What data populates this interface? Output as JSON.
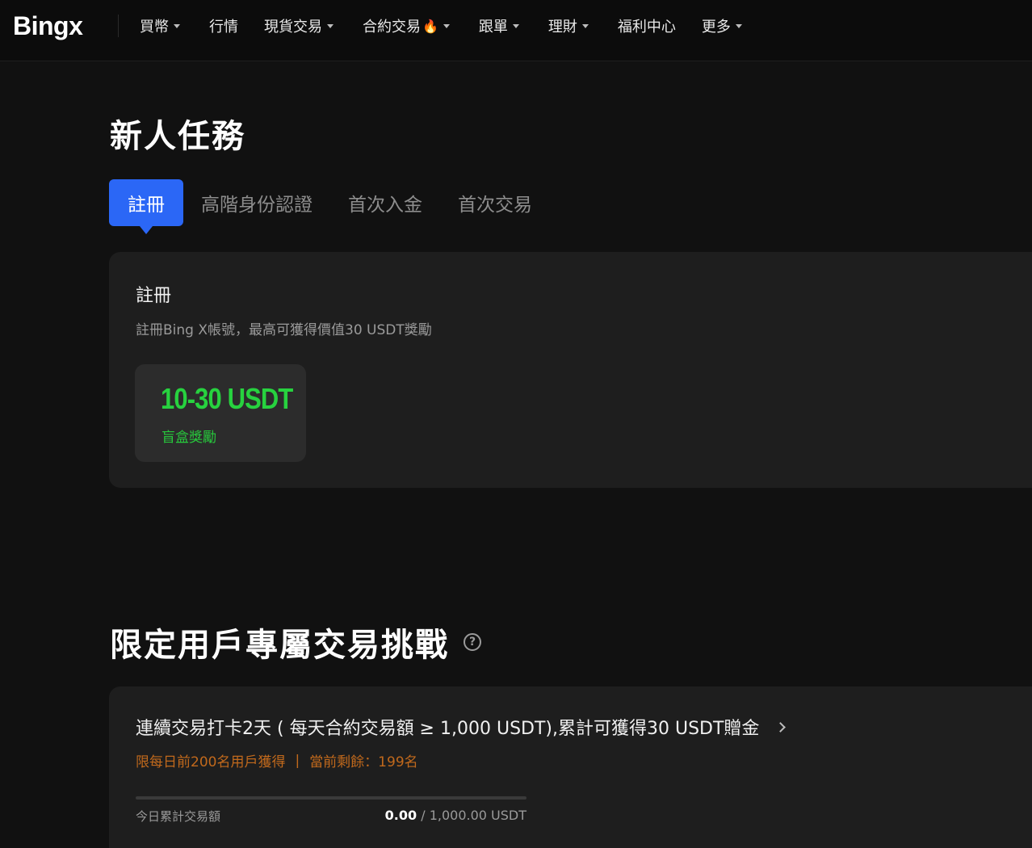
{
  "nav": {
    "logo": {
      "main": "Bing",
      "accent": "x"
    },
    "items": [
      {
        "label": "買幣",
        "dropdown": true,
        "fire": false
      },
      {
        "label": "行情",
        "dropdown": false,
        "fire": false
      },
      {
        "label": "現貨交易",
        "dropdown": true,
        "fire": false
      },
      {
        "label": "合約交易",
        "dropdown": true,
        "fire": true
      },
      {
        "label": "跟單",
        "dropdown": true,
        "fire": false
      },
      {
        "label": "理財",
        "dropdown": true,
        "fire": false
      },
      {
        "label": "福利中心",
        "dropdown": false,
        "fire": false
      },
      {
        "label": "更多",
        "dropdown": true,
        "fire": false
      }
    ]
  },
  "newbie": {
    "title": "新人任務",
    "tabs": [
      "註冊",
      "高階身份認證",
      "首次入金",
      "首次交易"
    ],
    "active_tab": 0,
    "card": {
      "title": "註冊",
      "desc": "註冊Bing X帳號，最高可獲得價值30 USDT獎勵",
      "reward_amount": "10-30 USDT",
      "reward_label": "盲盒獎勵"
    }
  },
  "challenge": {
    "title": "限定用戶專屬交易挑戰",
    "card": {
      "title": "連續交易打卡2天 ( 每天合約交易額 ≥ 1,000 USDT),累計可獲得30 USDT贈金",
      "limit": "限每日前200名用戶獲得",
      "separator": "|",
      "remaining": "當前剩餘：199名",
      "volume_label": "今日累計交易額",
      "volume_current": "0.00",
      "volume_target": " / 1,000.00 USDT",
      "progress": 0
    }
  },
  "colors": {
    "accent_blue": "#2b67f6",
    "reward_green": "#27d23f",
    "warning_orange": "#c1691c",
    "background": "#111111",
    "card": "#1e1e1e"
  }
}
